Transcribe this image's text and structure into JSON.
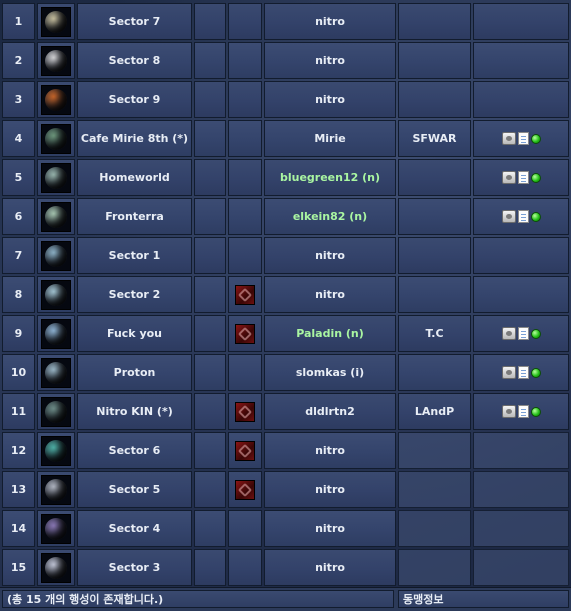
{
  "rows": [
    {
      "num": "1",
      "name": "Sector 7",
      "owner": "nitro",
      "owner_color": "white",
      "alliance": "",
      "has_emblem": false,
      "has_actions": false,
      "planet_color": "#c9c1a0"
    },
    {
      "num": "2",
      "name": "Sector 8",
      "owner": "nitro",
      "owner_color": "white",
      "alliance": "",
      "has_emblem": false,
      "has_actions": false,
      "planet_color": "#d6d6d8"
    },
    {
      "num": "3",
      "name": "Sector 9",
      "owner": "nitro",
      "owner_color": "white",
      "alliance": "",
      "has_emblem": false,
      "has_actions": false,
      "planet_color": "#c8662a"
    },
    {
      "num": "4",
      "name": "Cafe Mirie 8th (*)",
      "owner": "Mirie",
      "owner_color": "white",
      "alliance": "SFWAR",
      "has_emblem": false,
      "has_actions": true,
      "planet_color": "#6f9a7e"
    },
    {
      "num": "5",
      "name": "Homeworld",
      "owner": "bluegreen12 (n)",
      "owner_color": "green",
      "alliance": "",
      "has_emblem": false,
      "has_actions": true,
      "planet_color": "#9ab8b0"
    },
    {
      "num": "6",
      "name": "Fronterra",
      "owner": "elkein82 (n)",
      "owner_color": "green",
      "alliance": "",
      "has_emblem": false,
      "has_actions": true,
      "planet_color": "#a9c9b4"
    },
    {
      "num": "7",
      "name": "Sector 1",
      "owner": "nitro",
      "owner_color": "white",
      "alliance": "",
      "has_emblem": false,
      "has_actions": false,
      "planet_color": "#8fb4c9"
    },
    {
      "num": "8",
      "name": "Sector 2",
      "owner": "nitro",
      "owner_color": "white",
      "alliance": "",
      "has_emblem": true,
      "has_actions": false,
      "planet_color": "#a4c6d4"
    },
    {
      "num": "9",
      "name": "Fuck you",
      "owner": "Paladin (n)",
      "owner_color": "green",
      "alliance": "T.C",
      "has_emblem": true,
      "has_actions": true,
      "planet_color": "#8fb4d4"
    },
    {
      "num": "10",
      "name": "Proton",
      "owner": "slomkas (i)",
      "owner_color": "white",
      "alliance": "",
      "has_emblem": false,
      "has_actions": true,
      "planet_color": "#9cb9c9"
    },
    {
      "num": "11",
      "name": "Nitro KIN (*)",
      "owner": "dldlrtn2",
      "owner_color": "white",
      "alliance": "LAndP",
      "has_emblem": true,
      "has_actions": true,
      "planet_color": "#6f8f8a"
    },
    {
      "num": "12",
      "name": "Sector 6",
      "owner": "nitro",
      "owner_color": "white",
      "alliance": "",
      "has_emblem": true,
      "has_actions": false,
      "planet_color": "#4fb3a8"
    },
    {
      "num": "13",
      "name": "Sector 5",
      "owner": "nitro",
      "owner_color": "white",
      "alliance": "",
      "has_emblem": true,
      "has_actions": false,
      "planet_color": "#b3b8c4"
    },
    {
      "num": "14",
      "name": "Sector 4",
      "owner": "nitro",
      "owner_color": "white",
      "alliance": "",
      "has_emblem": false,
      "has_actions": false,
      "planet_color": "#8c7ab8"
    },
    {
      "num": "15",
      "name": "Sector 3",
      "owner": "nitro",
      "owner_color": "white",
      "alliance": "",
      "has_emblem": false,
      "has_actions": false,
      "planet_color": "#c3c7d8"
    }
  ],
  "footer": {
    "summary": "(총 15 개의 행성이 존재합니다.)",
    "alliance_info": "동맹정보"
  },
  "colors": {
    "green_text": "#a9f5a1",
    "online_dot": "#26c21a"
  }
}
